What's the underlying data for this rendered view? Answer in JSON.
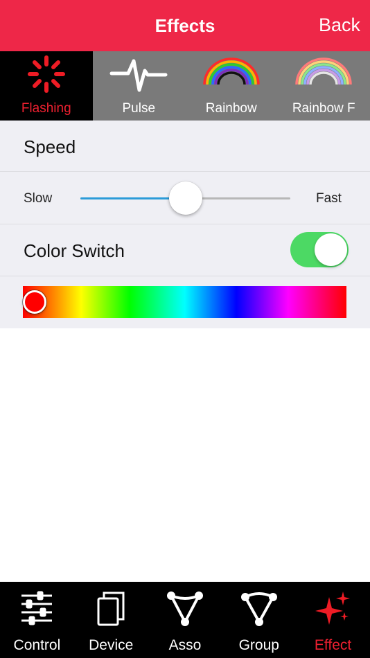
{
  "navbar": {
    "title": "Effects",
    "back_label": "Back"
  },
  "effect_tabs": [
    {
      "label": "Flashing",
      "icon": "flash-burst-icon",
      "active": true
    },
    {
      "label": "Pulse",
      "icon": "pulse-icon",
      "active": false
    },
    {
      "label": "Rainbow",
      "icon": "rainbow-icon",
      "active": false
    },
    {
      "label": "Rainbow F",
      "icon": "rainbow-fade-icon",
      "active": false
    }
  ],
  "speed": {
    "title": "Speed",
    "min_label": "Slow",
    "max_label": "Fast",
    "value": 0.5
  },
  "color_switch": {
    "label": "Color Switch",
    "on": true
  },
  "color_picker": {
    "selected_color": "#ff0000",
    "position": 0.03
  },
  "tabbar": [
    {
      "label": "Control",
      "icon": "sliders-icon",
      "active": false
    },
    {
      "label": "Device",
      "icon": "device-stack-icon",
      "active": false
    },
    {
      "label": "Asso",
      "icon": "triangle-nodes-icon",
      "active": false
    },
    {
      "label": "Group",
      "icon": "group-triangle-icon",
      "active": false
    },
    {
      "label": "Effect",
      "icon": "sparkle-icon",
      "active": true
    }
  ],
  "colors": {
    "accent": "#ee2748",
    "active_red": "#ee2030",
    "slider_blue": "#2b9bd8",
    "switch_green": "#4cd964"
  }
}
